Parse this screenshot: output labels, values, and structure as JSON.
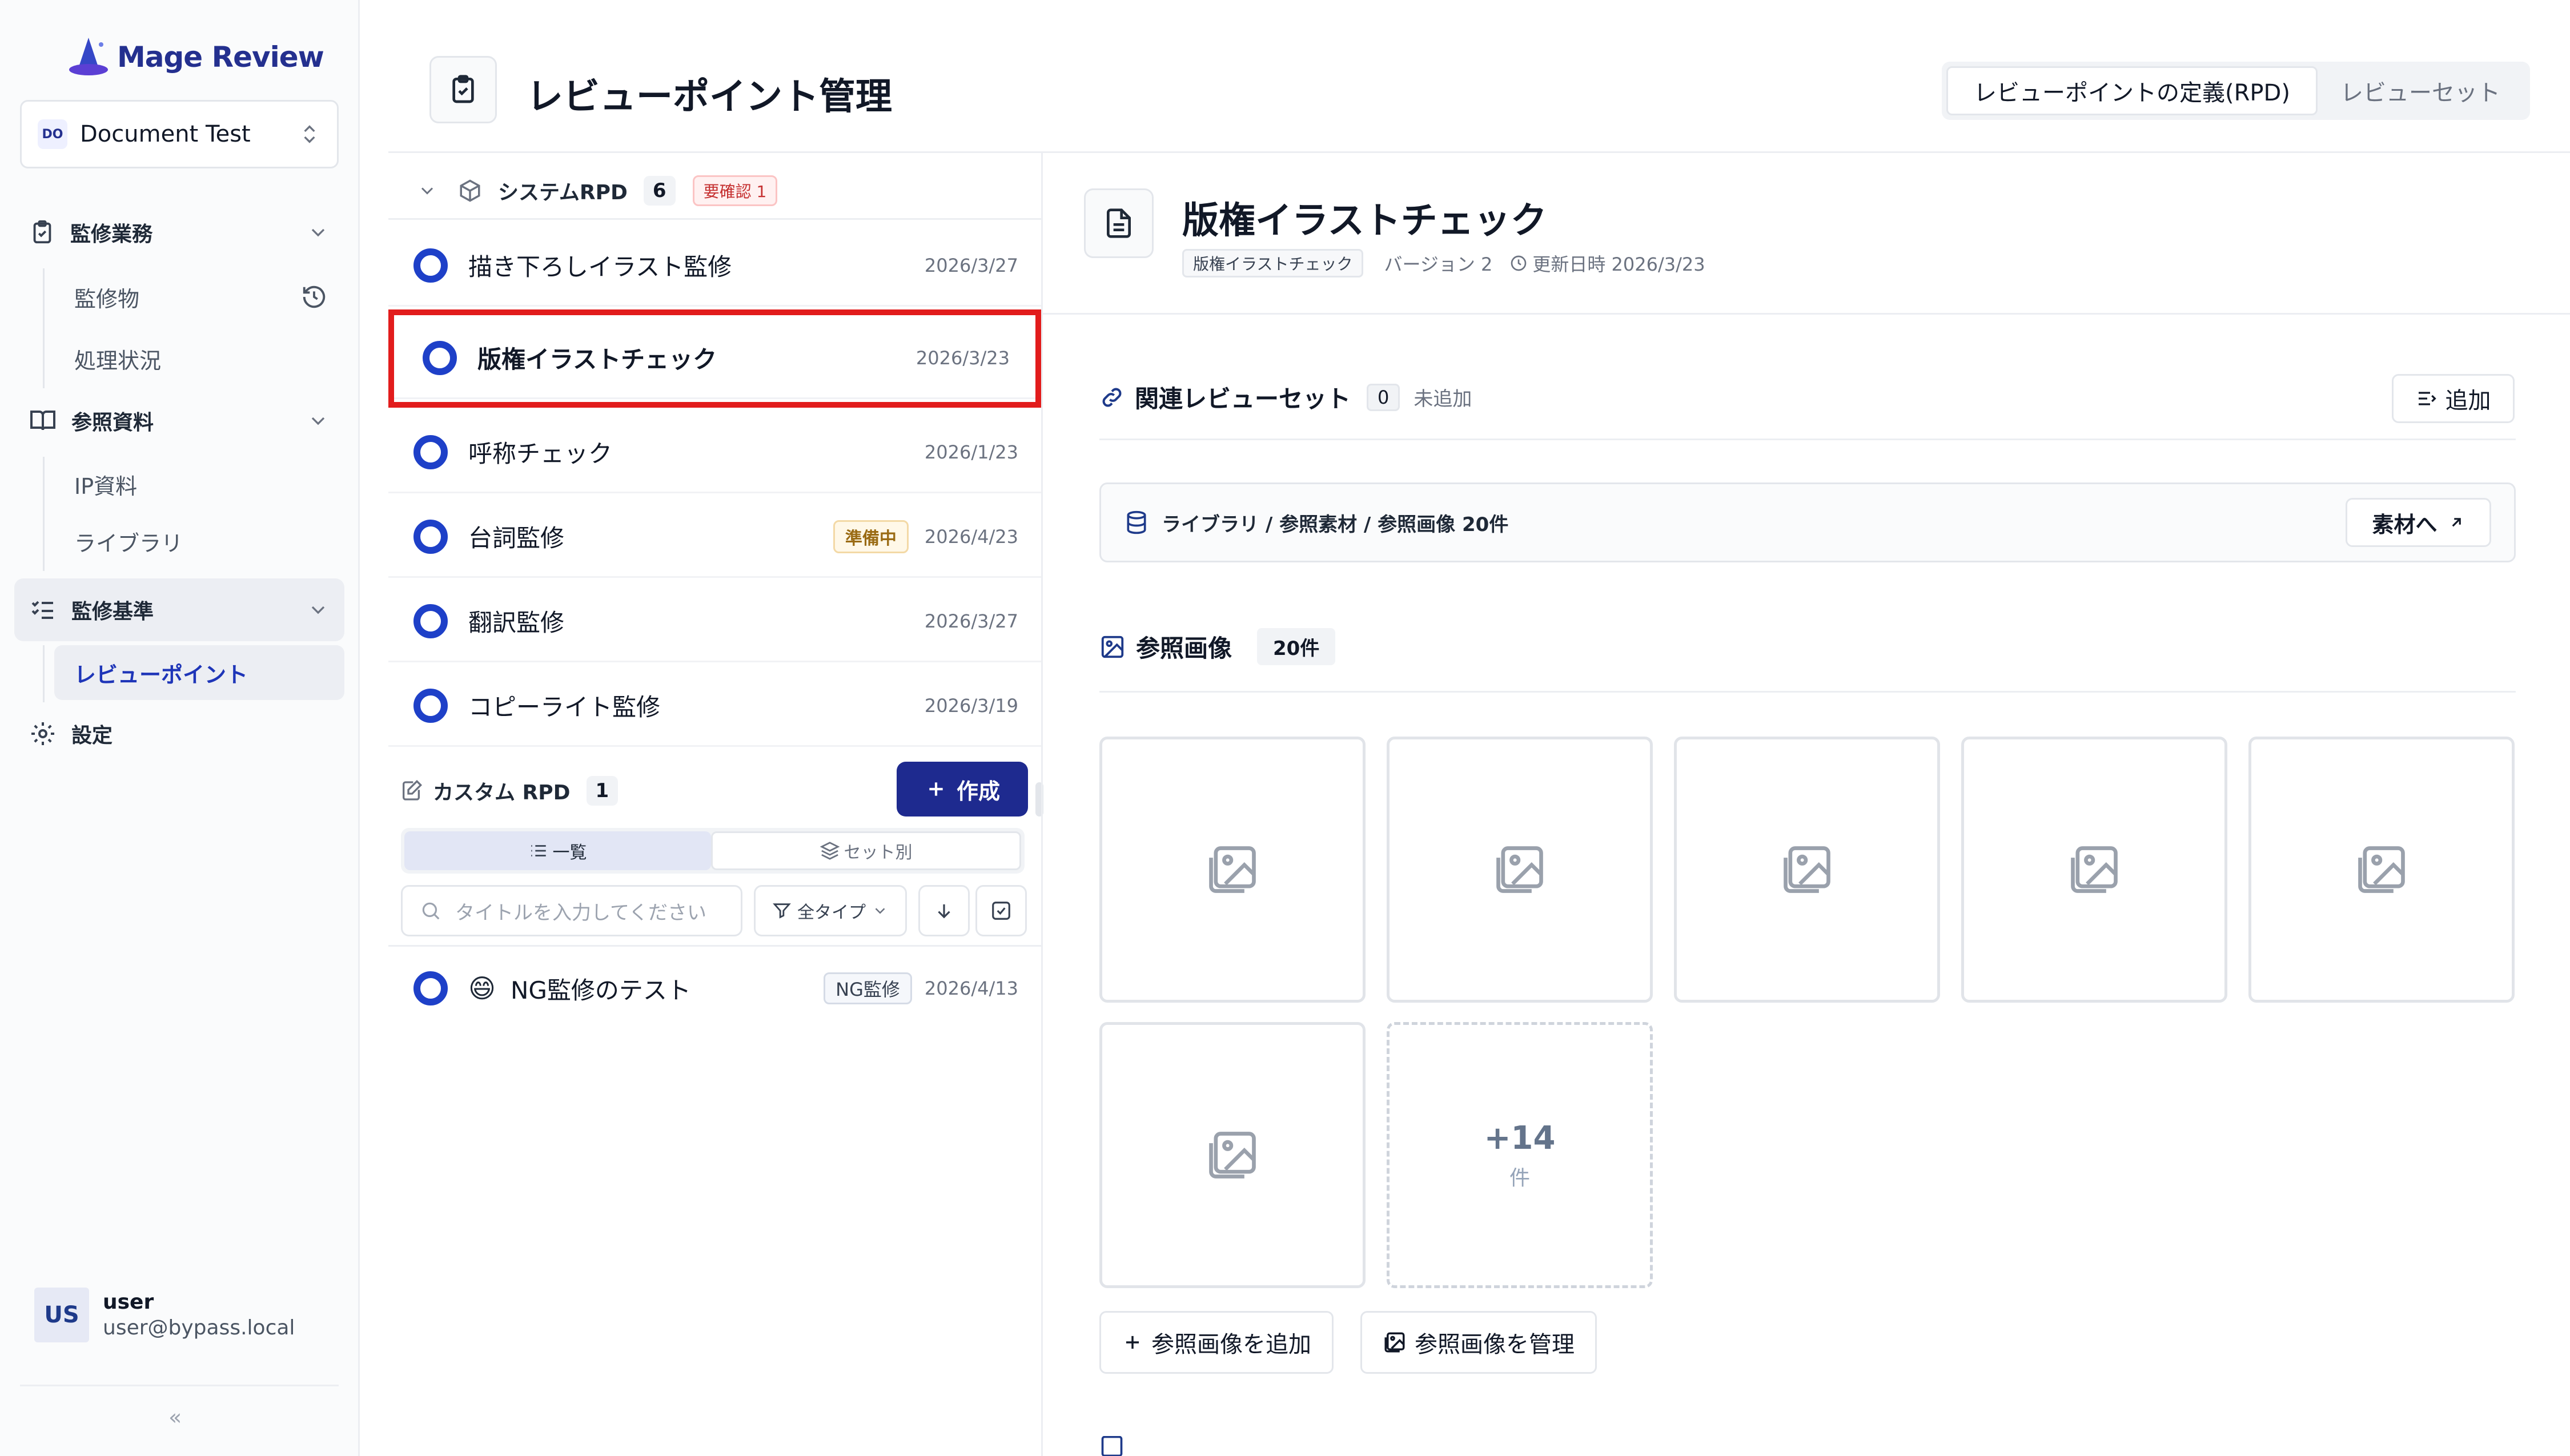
{
  "sidebar": {
    "logo_text": "Mage Review",
    "workspace_badge": "DO",
    "workspace_name": "Document Test",
    "groups": [
      {
        "label": "監修業務"
      },
      {
        "label": "参照資料"
      },
      {
        "label": "監修基準"
      },
      {
        "label": "設定"
      }
    ],
    "subs": {
      "kanshubutsu": "監修物",
      "shori": "処理状況",
      "ip": "IP資料",
      "library": "ライブラリ",
      "reviewpoint": "レビューポイント"
    },
    "user": {
      "initials": "US",
      "name": "user",
      "email": "user@bypass.local"
    },
    "collapse": "«"
  },
  "header": {
    "title": "レビューポイント管理",
    "tabs": [
      {
        "label": "レビューポイントの定義(RPD)",
        "active": true
      },
      {
        "label": "レビューセット",
        "active": false
      }
    ]
  },
  "list": {
    "system": {
      "title": "システムRPD",
      "count": "6",
      "warn": "要確認 1"
    },
    "items": [
      {
        "title": "描き下ろしイラスト監修",
        "date": "2026/3/27"
      },
      {
        "title": "版権イラストチェック",
        "date": "2026/3/23"
      },
      {
        "title": "呼称チェック",
        "date": "2026/1/23"
      },
      {
        "title": "台詞監修",
        "date": "2026/4/23",
        "badge": "準備中"
      },
      {
        "title": "翻訳監修",
        "date": "2026/3/27"
      },
      {
        "title": "コピーライト監修",
        "date": "2026/3/19"
      }
    ],
    "custom": {
      "title": "カスタム RPD",
      "count": "1",
      "create_label": "作成"
    },
    "view_tabs": [
      {
        "label": "一覧",
        "active": true
      },
      {
        "label": "セット別",
        "active": false
      }
    ],
    "search_placeholder": "タイトルを入力してください",
    "filter_label": "全タイプ",
    "custom_items": [
      {
        "emoji": "😄",
        "title": "NG監修のテスト",
        "badge": "NG監修",
        "date": "2026/4/13"
      }
    ]
  },
  "detail": {
    "title": "版権イラストチェック",
    "tag": "版権イラストチェック",
    "version": "バージョン 2",
    "updated": "更新日時 2026/3/23",
    "related": {
      "title": "関連レビューセット",
      "count": "0",
      "sub": "未追加",
      "add_label": "追加"
    },
    "library": {
      "path": "ライブラリ / 参照素材 / 参照画像 20件",
      "button": "素材へ"
    },
    "images": {
      "title": "参照画像",
      "count": "20件",
      "more_num": "+14",
      "more_unit": "件"
    },
    "actions": {
      "add": "参照画像を追加",
      "manage": "参照画像を管理"
    }
  },
  "colors": {
    "brand": "#24308f",
    "accent": "#1e40c8",
    "highlight": "#e21c1c"
  }
}
